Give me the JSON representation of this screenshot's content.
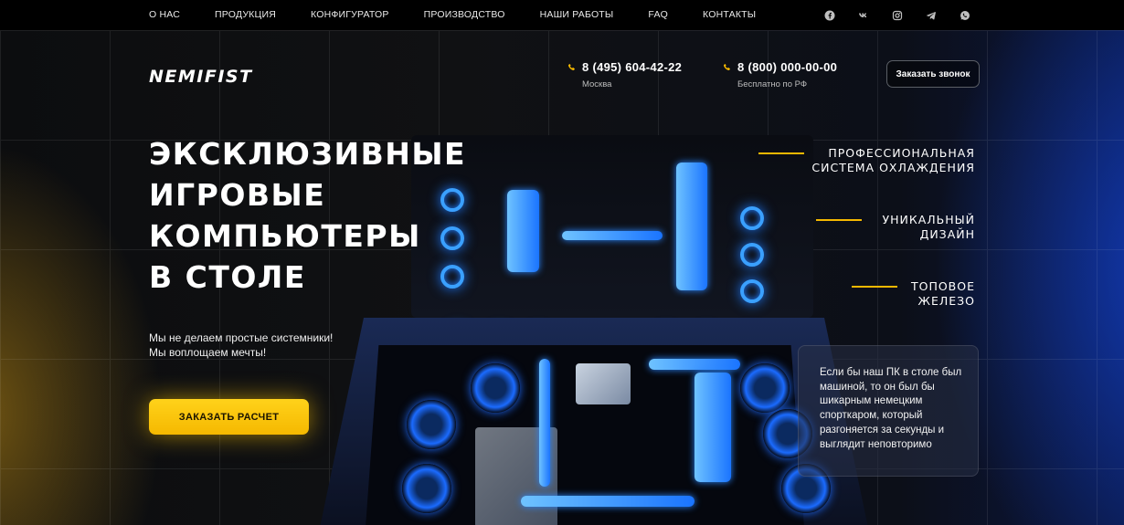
{
  "nav": {
    "items": [
      "О НАС",
      "ПРОДУКЦИЯ",
      "КОНФИГУРАТОР",
      "ПРОИЗВОДСТВО",
      "НАШИ РАБОТЫ",
      "FAQ",
      "КОНТАКТЫ"
    ]
  },
  "socials": [
    "facebook-icon",
    "vk-icon",
    "instagram-icon",
    "telegram-icon",
    "whatsapp-icon"
  ],
  "header": {
    "logo": "NEMIFIST",
    "phone1": {
      "number": "8 (495) 604-42-22",
      "caption": "Москва"
    },
    "phone2": {
      "number": "8 (800) 000-00-00",
      "caption": "Бесплатно по РФ"
    },
    "callback_label": "Заказать звонок"
  },
  "hero": {
    "title_lines": [
      "ЭКСКЛЮЗИВНЫЕ",
      "ИГРОВЫЕ",
      "КОМПЬЮТЕРЫ",
      "В СТОЛЕ"
    ],
    "lead_lines": [
      "Мы не делаем простые системники!",
      "Мы воплощаем мечты!"
    ],
    "cta_label": "ЗАКАЗАТЬ РАСЧЕТ"
  },
  "features": [
    {
      "lines": [
        "ПРОФЕССИОНАЛЬНАЯ",
        "СИСТЕМА ОХЛАЖДЕНИЯ"
      ]
    },
    {
      "lines": [
        "УНИКАЛЬНЫЙ",
        "ДИЗАЙН"
      ]
    },
    {
      "lines": [
        "ТОПОВОЕ",
        "ЖЕЛЕЗО"
      ]
    }
  ],
  "quote": {
    "text": "Если бы наш ПК в столе был машиной, то он был бы шикарным немецким спорткаром, который разгоняется за секунды и выглядит неповторимо"
  },
  "colors": {
    "accent": "#F5B800",
    "glow_blue": "#1E7BFF",
    "background": "#0C0D0F"
  }
}
